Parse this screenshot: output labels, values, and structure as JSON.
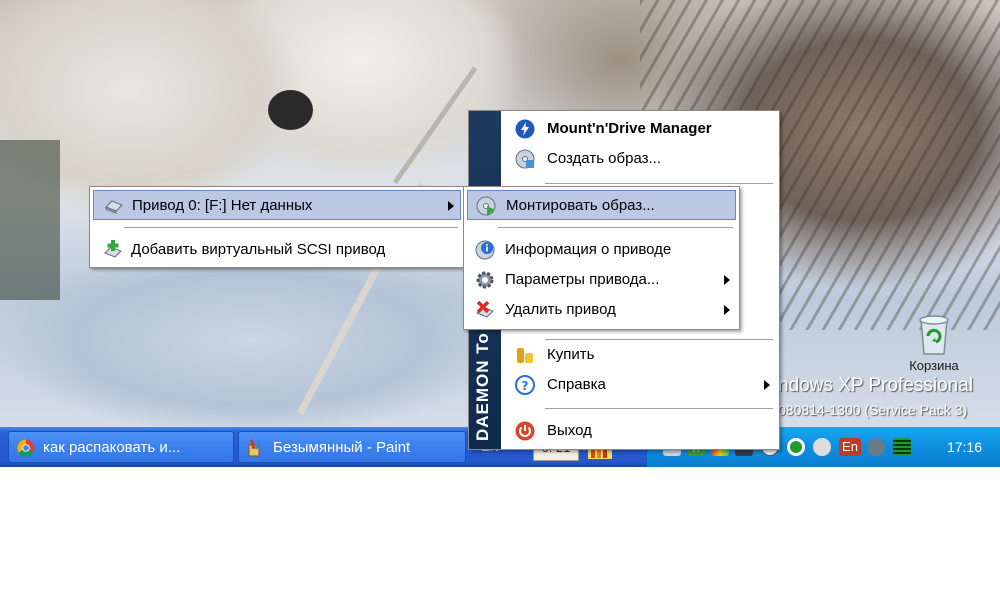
{
  "desktop": {
    "watermark_line1": "ndows XP Professional",
    "watermark_line2": "080814-1300 (Service Pack 3)",
    "recycle_bin_label": "Корзина"
  },
  "main_menu": {
    "sidebar_text": "DAEMON To",
    "items": [
      {
        "label": "Mount'n'Drive Manager",
        "icon": "lightning-icon",
        "bold": true
      },
      {
        "label": "Создать образ...",
        "icon": "disc-create-icon"
      },
      {
        "label": "Купить",
        "icon": "coins-icon"
      },
      {
        "label": "Справка",
        "icon": "help-icon",
        "submenu": true
      },
      {
        "label": "Выход",
        "icon": "power-icon"
      }
    ]
  },
  "drive_menu": {
    "items": [
      {
        "label": "Привод 0: [F:] Нет данных",
        "icon": "drive-icon",
        "highlighted": true,
        "submenu": true
      },
      {
        "label": "Добавить виртуальный SCSI привод",
        "icon": "add-drive-icon"
      }
    ]
  },
  "drive_submenu": {
    "items": [
      {
        "label": "Монтировать образ...",
        "icon": "mount-icon",
        "highlighted": true,
        "submenu": true
      },
      {
        "label": "Информация о приводе",
        "icon": "info-icon"
      },
      {
        "label": "Параметры привода...",
        "icon": "settings-icon",
        "submenu": true
      },
      {
        "label": "Удалить привод",
        "icon": "remove-icon",
        "submenu": true
      }
    ]
  },
  "taskbar": {
    "tasks": [
      {
        "label": "как распаковать и...",
        "icon": "chrome-icon"
      },
      {
        "label": "Безымянный - Paint",
        "icon": "paint-icon"
      }
    ],
    "language_hidden": "EN",
    "partial_clock_box": "6: 21",
    "tray_lang": "En",
    "clock": "17:16"
  },
  "colors": {
    "menu_highlight": "#bcc7e4",
    "taskbar_blue": "#245bd0",
    "tray_blue": "#0e8ee0",
    "daemon_bar": "#1d3a5e"
  }
}
